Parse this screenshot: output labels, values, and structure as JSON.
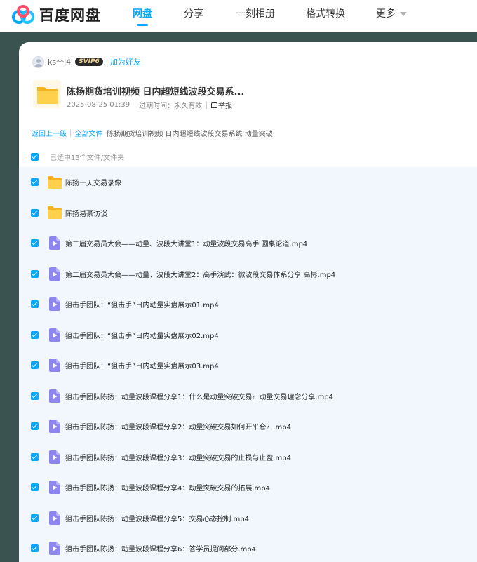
{
  "app": {
    "logo_text": "百度网盘",
    "brand_color": "#06a7ff"
  },
  "nav": {
    "items": [
      {
        "label": "网盘",
        "active": true
      },
      {
        "label": "分享",
        "active": false
      },
      {
        "label": "一刻相册",
        "active": false
      },
      {
        "label": "格式转换",
        "active": false
      },
      {
        "label": "更多",
        "active": false
      }
    ]
  },
  "share": {
    "username": "ks**l4",
    "badge": "SVIP6",
    "add_friend": "加为好友",
    "title": "陈扬期货培训视频 日内超短线波段交易系...",
    "date": "2025-08-25 01:39",
    "expire": "过期时间：永久有效",
    "report": "举报"
  },
  "breadcrumb": {
    "back": "返回上一级",
    "sep": "|",
    "all_files": "全部文件",
    "current": "陈扬期货培训视频 日内超短线波段交易系统 动量突破"
  },
  "selection": {
    "text": "已选中13个文件/文件夹",
    "checked": true
  },
  "files": [
    {
      "name": "陈扬一天交易录像",
      "type": "folder",
      "checked": true
    },
    {
      "name": "陈扬易豪访谈",
      "type": "folder",
      "checked": true
    },
    {
      "name": "第二届交易员大会——动量、波段大讲堂1：动量波段交易高手 圆桌论道.mp4",
      "type": "video",
      "checked": true
    },
    {
      "name": "第二届交易员大会——动量、波段大讲堂2：高手演武：微波段交易体系分享 高彬.mp4",
      "type": "video",
      "checked": true
    },
    {
      "name": "狙击手团队：“狙击手”日内动量实盘展示01.mp4",
      "type": "video",
      "checked": true
    },
    {
      "name": "狙击手团队：“狙击手”日内动量实盘展示02.mp4",
      "type": "video",
      "checked": true
    },
    {
      "name": "狙击手团队：“狙击手”日内动量实盘展示03.mp4",
      "type": "video",
      "checked": true
    },
    {
      "name": "狙击手团队陈扬：动量波段课程分享1：什么是动量突破交易？动量交易理念分享.mp4",
      "type": "video",
      "checked": true
    },
    {
      "name": "狙击手团队陈扬：动量波段课程分享2：动量突破交易如何开平仓？.mp4",
      "type": "video",
      "checked": true
    },
    {
      "name": "狙击手团队陈扬：动量波段课程分享3：动量突破交易的止损与止盈.mp4",
      "type": "video",
      "checked": true
    },
    {
      "name": "狙击手团队陈扬：动量波段课程分享4：动量突破交易的拓展.mp4",
      "type": "video",
      "checked": true
    },
    {
      "name": "狙击手团队陈扬：动量波段课程分享5：交易心态控制.mp4",
      "type": "video",
      "checked": true
    },
    {
      "name": "狙击手团队陈扬：动量波段课程分享6：答学员提问部分.mp4",
      "type": "video",
      "checked": true
    }
  ]
}
